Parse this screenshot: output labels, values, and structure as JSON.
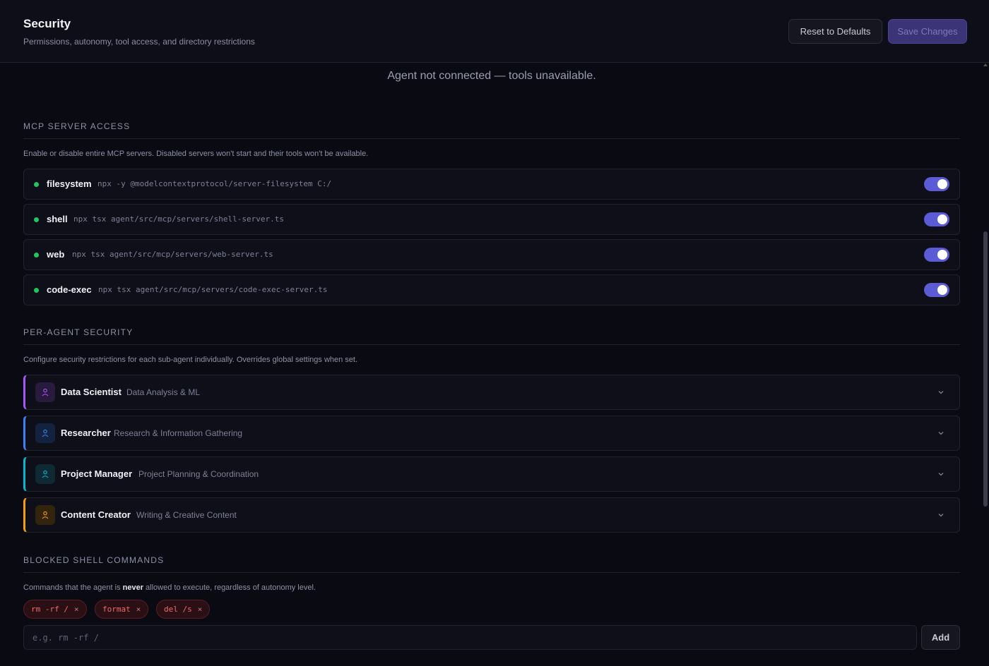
{
  "header": {
    "title": "Security",
    "subtitle": "Permissions, autonomy, tool access, and directory restrictions",
    "reset_label": "Reset to Defaults",
    "save_label": "Save Changes"
  },
  "notice": "Agent not connected — tools unavailable.",
  "mcp": {
    "title": "MCP SERVER ACCESS",
    "description": "Enable or disable entire MCP servers. Disabled servers won't start and their tools won't be available.",
    "servers": [
      {
        "name": "filesystem",
        "command": "npx -y @modelcontextprotocol/server-filesystem C:/",
        "enabled": true,
        "status_color": "#22c55e"
      },
      {
        "name": "shell",
        "command": "npx tsx agent/src/mcp/servers/shell-server.ts",
        "enabled": true,
        "status_color": "#22c55e"
      },
      {
        "name": "web",
        "command": "npx tsx agent/src/mcp/servers/web-server.ts",
        "enabled": true,
        "status_color": "#22c55e"
      },
      {
        "name": "code-exec",
        "command": "npx tsx agent/src/mcp/servers/code-exec-server.ts",
        "enabled": true,
        "status_color": "#22c55e"
      }
    ]
  },
  "agents": {
    "title": "PER-AGENT SECURITY",
    "description": "Configure security restrictions for each sub-agent individually. Overrides global settings when set.",
    "items": [
      {
        "name": "Data Scientist",
        "role": "Data Analysis & ML",
        "color": "#a855f7",
        "icon": "user-icon"
      },
      {
        "name": "Researcher",
        "role": "Research & Information Gathering",
        "color": "#3b82f6",
        "icon": "user-icon"
      },
      {
        "name": "Project Manager",
        "role": "Project Planning & Coordination",
        "color": "#06b6d4",
        "icon": "user-icon"
      },
      {
        "name": "Content Creator",
        "role": "Writing & Creative Content",
        "color": "#f59e0b",
        "icon": "user-icon"
      }
    ]
  },
  "blocked": {
    "title": "BLOCKED SHELL COMMANDS",
    "desc_prefix": "Commands that the agent is ",
    "desc_emphasis": "never",
    "desc_suffix": " allowed to execute, regardless of autonomy level.",
    "commands": [
      "rm -rf /",
      "format",
      "del /s"
    ],
    "input_placeholder": "e.g. rm -rf /",
    "input_value": "",
    "add_label": "Add"
  },
  "colors": {
    "accent": "#5b5bd6",
    "status_green": "#22c55e",
    "danger": "#f06a6a"
  }
}
